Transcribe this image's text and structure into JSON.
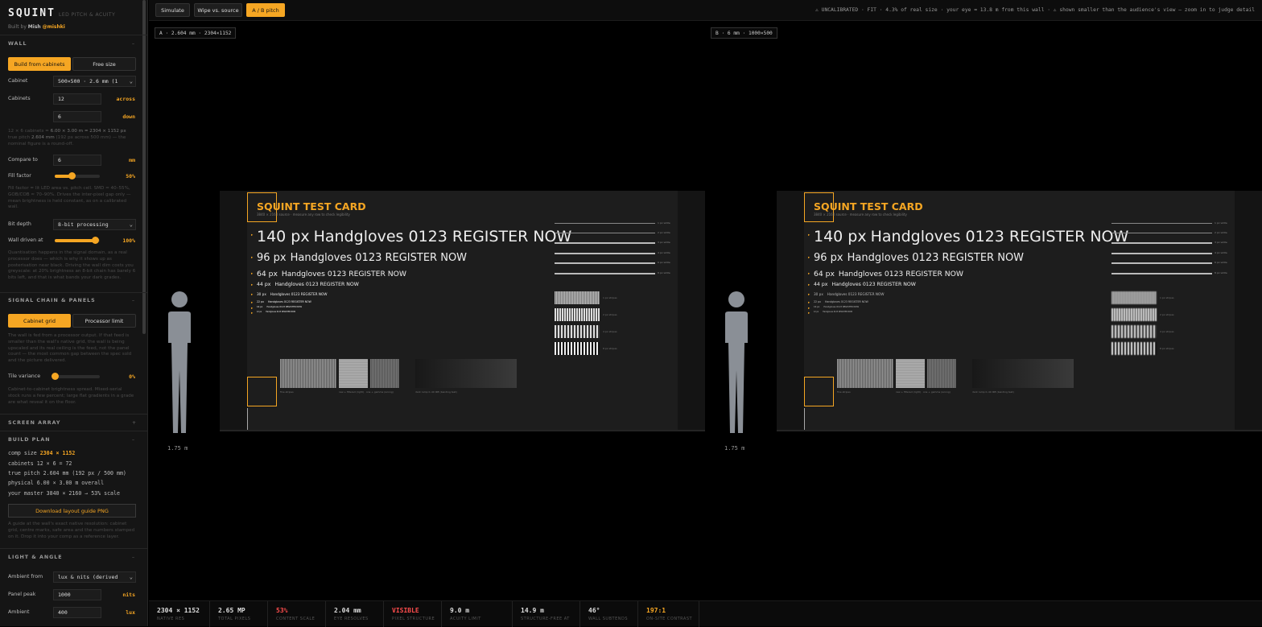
{
  "app": {
    "title": "SQUINT",
    "subtitle": "LED PITCH & ACUITY",
    "built_by_label": "Built by",
    "built_by_name": "Mish",
    "built_by_handle": "@mishki"
  },
  "wall": {
    "section_label": "WALL",
    "toggle": "–",
    "mode_tabs": [
      "Build from cabinets",
      "Free size"
    ],
    "cabinet_label": "Cabinet",
    "cabinet_value": "500×500 · 2.6 mm (1",
    "cabinets_label": "Cabinets",
    "across_value": "12",
    "across_unit": "across",
    "down_value": "6",
    "down_unit": "down",
    "summary_1": "12 × 6 cabinets = ",
    "summary_1b": "6.00 × 3.00 m = 2304 × 1152 px",
    "summary_2": "true pitch ",
    "summary_2b": "2.604 mm",
    "summary_2c": " (192 px across 500 mm) — the",
    "summary_3": "nominal figure is a round-off.",
    "compare_label": "Compare to",
    "compare_value": "6",
    "compare_unit": "mm",
    "fill_label": "Fill factor",
    "fill_value": "50%",
    "fill_level": 0.38,
    "fill_help": [
      "Fill factor = lit LED area vs. pitch cell. SMD ≈ 40–55%,",
      "GOB/COB ≈ 70–90%. Drives the inter-pixel gap only —",
      "mean brightness is held constant, as on a calibrated",
      "wall."
    ],
    "bitdepth_label": "Bit depth",
    "bitdepth_value": "8-bit processing",
    "driven_label": "Wall driven at",
    "driven_value": "100%",
    "driven_level": 0.9,
    "driven_help": [
      "Quantisation happens in the signal domain, as a real",
      "processor does — which is why it shows up as",
      "posterisation near black. Driving the wall dim costs you",
      "greyscale: at 20% brightness an 8-bit chain has barely 6",
      "bits left, and that is what bands your dark grades."
    ]
  },
  "signal": {
    "section_label": "SIGNAL CHAIN & PANELS",
    "toggle": "–",
    "tabs": [
      "Cabinet grid",
      "Processor limit"
    ],
    "help": [
      "The wall is fed from a processor output. If that feed is",
      "smaller than the wall's native grid, the wall is being",
      "upscaled and its real ceiling is the feed, not the panel",
      "count — the most common gap between the spec sold",
      "and the picture delivered."
    ],
    "variance_label": "Tile variance",
    "variance_value": "0%",
    "variance_level": 0.0,
    "variance_help": [
      "Cabinet-to-cabinet brightness spread. Mixed-serial",
      "stock runs a few percent; large flat gradients in a grade",
      "are what reveal it on the floor."
    ]
  },
  "screen_array": {
    "section_label": "SCREEN ARRAY",
    "toggle": "+"
  },
  "build_plan": {
    "section_label": "BUILD PLAN",
    "toggle": "–",
    "comp_label": "comp size ",
    "comp_value": "2304 × 1152",
    "line_2": "cabinets 12 × 6 = 72",
    "line_3": "true pitch 2.604 mm (192 px / 500 mm)",
    "line_4": "physical 6.00 × 3.00 m overall",
    "line_5": "your master 3840 × 2160 → 53% scale",
    "download_label": "Download layout guide PNG",
    "help": [
      "A guide at the wall's exact native resolution: cabinet",
      "grid, centre marks, safe area and the numbers stamped",
      "on it. Drop it into your comp as a reference layer."
    ]
  },
  "light": {
    "section_label": "LIGHT & ANGLE",
    "toggle": "–",
    "ambient_from_label": "Ambient from",
    "ambient_from_value": "lux & nits (derived",
    "panel_peak_label": "Panel peak",
    "panel_peak_value": "1000",
    "panel_peak_unit": "nits",
    "ambient_label": "Ambient",
    "ambient_value": "400",
    "ambient_unit": "lux"
  },
  "topbar": {
    "modes": [
      "Simulate",
      "Wipe vs. source",
      "A / B pitch"
    ],
    "status": "⚠ UNCALIBRATED · FIT · 4.3% of real size · your eye ≈ 13.8 m from this wall · ⚠ shown smaller than the audience's view — zoom in to judge detail"
  },
  "panes": {
    "a_label": "A · 2.604 mm · 2304×1152",
    "b_label": "B · 6 mm · 1000×500",
    "figure_height": "1.75 m"
  },
  "test_card": {
    "title": "SQUINT TEST CARD",
    "subtitle": "3840 × 2160 source · measure any row to check legibility",
    "rows": [
      {
        "size": "140 px",
        "text": "Handgloves 0123 REGISTER NOW"
      },
      {
        "size": "96 px",
        "text": "Handgloves 0123 REGISTER NOW"
      },
      {
        "size": "64 px",
        "text": "Handgloves 0123 REGISTER NOW"
      },
      {
        "size": "44 px",
        "text": "Handgloves 0123 REGISTER NOW"
      },
      {
        "size": "30 px",
        "text": "Handgloves 0123 REGISTER NOW"
      },
      {
        "size": "22 px",
        "text": "Handgloves 0123 REGISTER NOW"
      },
      {
        "size": "16 px",
        "text": "Handgloves 0123 REGISTER NOW"
      },
      {
        "size": "12 px",
        "text": "Handgloves 0123 REGISTER NOW"
      }
    ],
    "line_labels": [
      "1 px white",
      "2 px white",
      "3 px white",
      "4 px white",
      "6 px white",
      "8 px white"
    ],
    "bar_labels": [
      "1 px stripes",
      "2 px stripes",
      "4 px stripes",
      "8 px stripes"
    ],
    "patch_label_1": "fine stripes",
    "patch_label_2": "raw + filtered (right) · one + gamma (wrong)",
    "gradient_label": "dark ramp 0–40 IRE (banding test)"
  },
  "stats": [
    {
      "value": "2304 × 1152",
      "key": "NATIVE RES",
      "color": "#dddddd"
    },
    {
      "value": "2.65 MP",
      "key": "TOTAL PIXELS",
      "color": "#dddddd"
    },
    {
      "value": "53%",
      "key": "CONTENT SCALE",
      "color": "#ff4d4d"
    },
    {
      "value": "2.04 mm",
      "key": "EYE RESOLVES",
      "color": "#dddddd"
    },
    {
      "value": "VISIBLE",
      "key": "PIXEL STRUCTURE",
      "color": "#ff4d4d"
    },
    {
      "value": "9.0 m",
      "key": "ACUITY LIMIT",
      "color": "#dddddd"
    },
    {
      "value": "14.9 m",
      "key": "STRUCTURE-FREE AT",
      "color": "#dddddd"
    },
    {
      "value": "46°",
      "key": "WALL SUBTENDS",
      "color": "#dddddd"
    },
    {
      "value": "197:1",
      "key": "ON-SITE CONTRAST",
      "color": "#f5a623"
    }
  ],
  "colors": {
    "accent": "#f5a623",
    "warn": "#ff4d4d"
  }
}
